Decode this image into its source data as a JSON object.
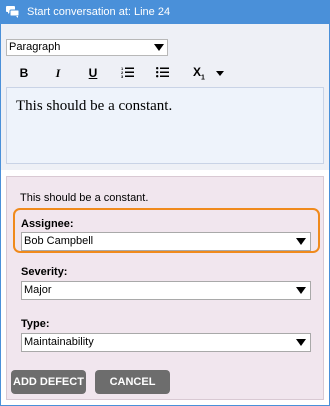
{
  "window": {
    "title": "Start conversation at: Line 24",
    "title_icon": "chat-bubbles-icon",
    "accent_color": "#4a90d9"
  },
  "editor": {
    "format_select": "Paragraph",
    "toolbar": {
      "bold_label": "B",
      "italic_label": "I",
      "underline_label": "U",
      "ordered_list_icon": "ordered-list-icon",
      "bullet_list_icon": "bullet-list-icon",
      "subscript_label": "X",
      "subscript_sub": "1"
    },
    "text": "This should be a constant."
  },
  "form": {
    "preview_text": "This should be a constant.",
    "assignee": {
      "label": "Assignee:",
      "value": "Bob Campbell"
    },
    "severity": {
      "label": "Severity:",
      "value": "Major"
    },
    "type": {
      "label": "Type:",
      "value": "Maintainability"
    },
    "highlight_color": "#f08a1c",
    "add_button": "ADD DEFECT",
    "cancel_button": "CANCEL"
  }
}
